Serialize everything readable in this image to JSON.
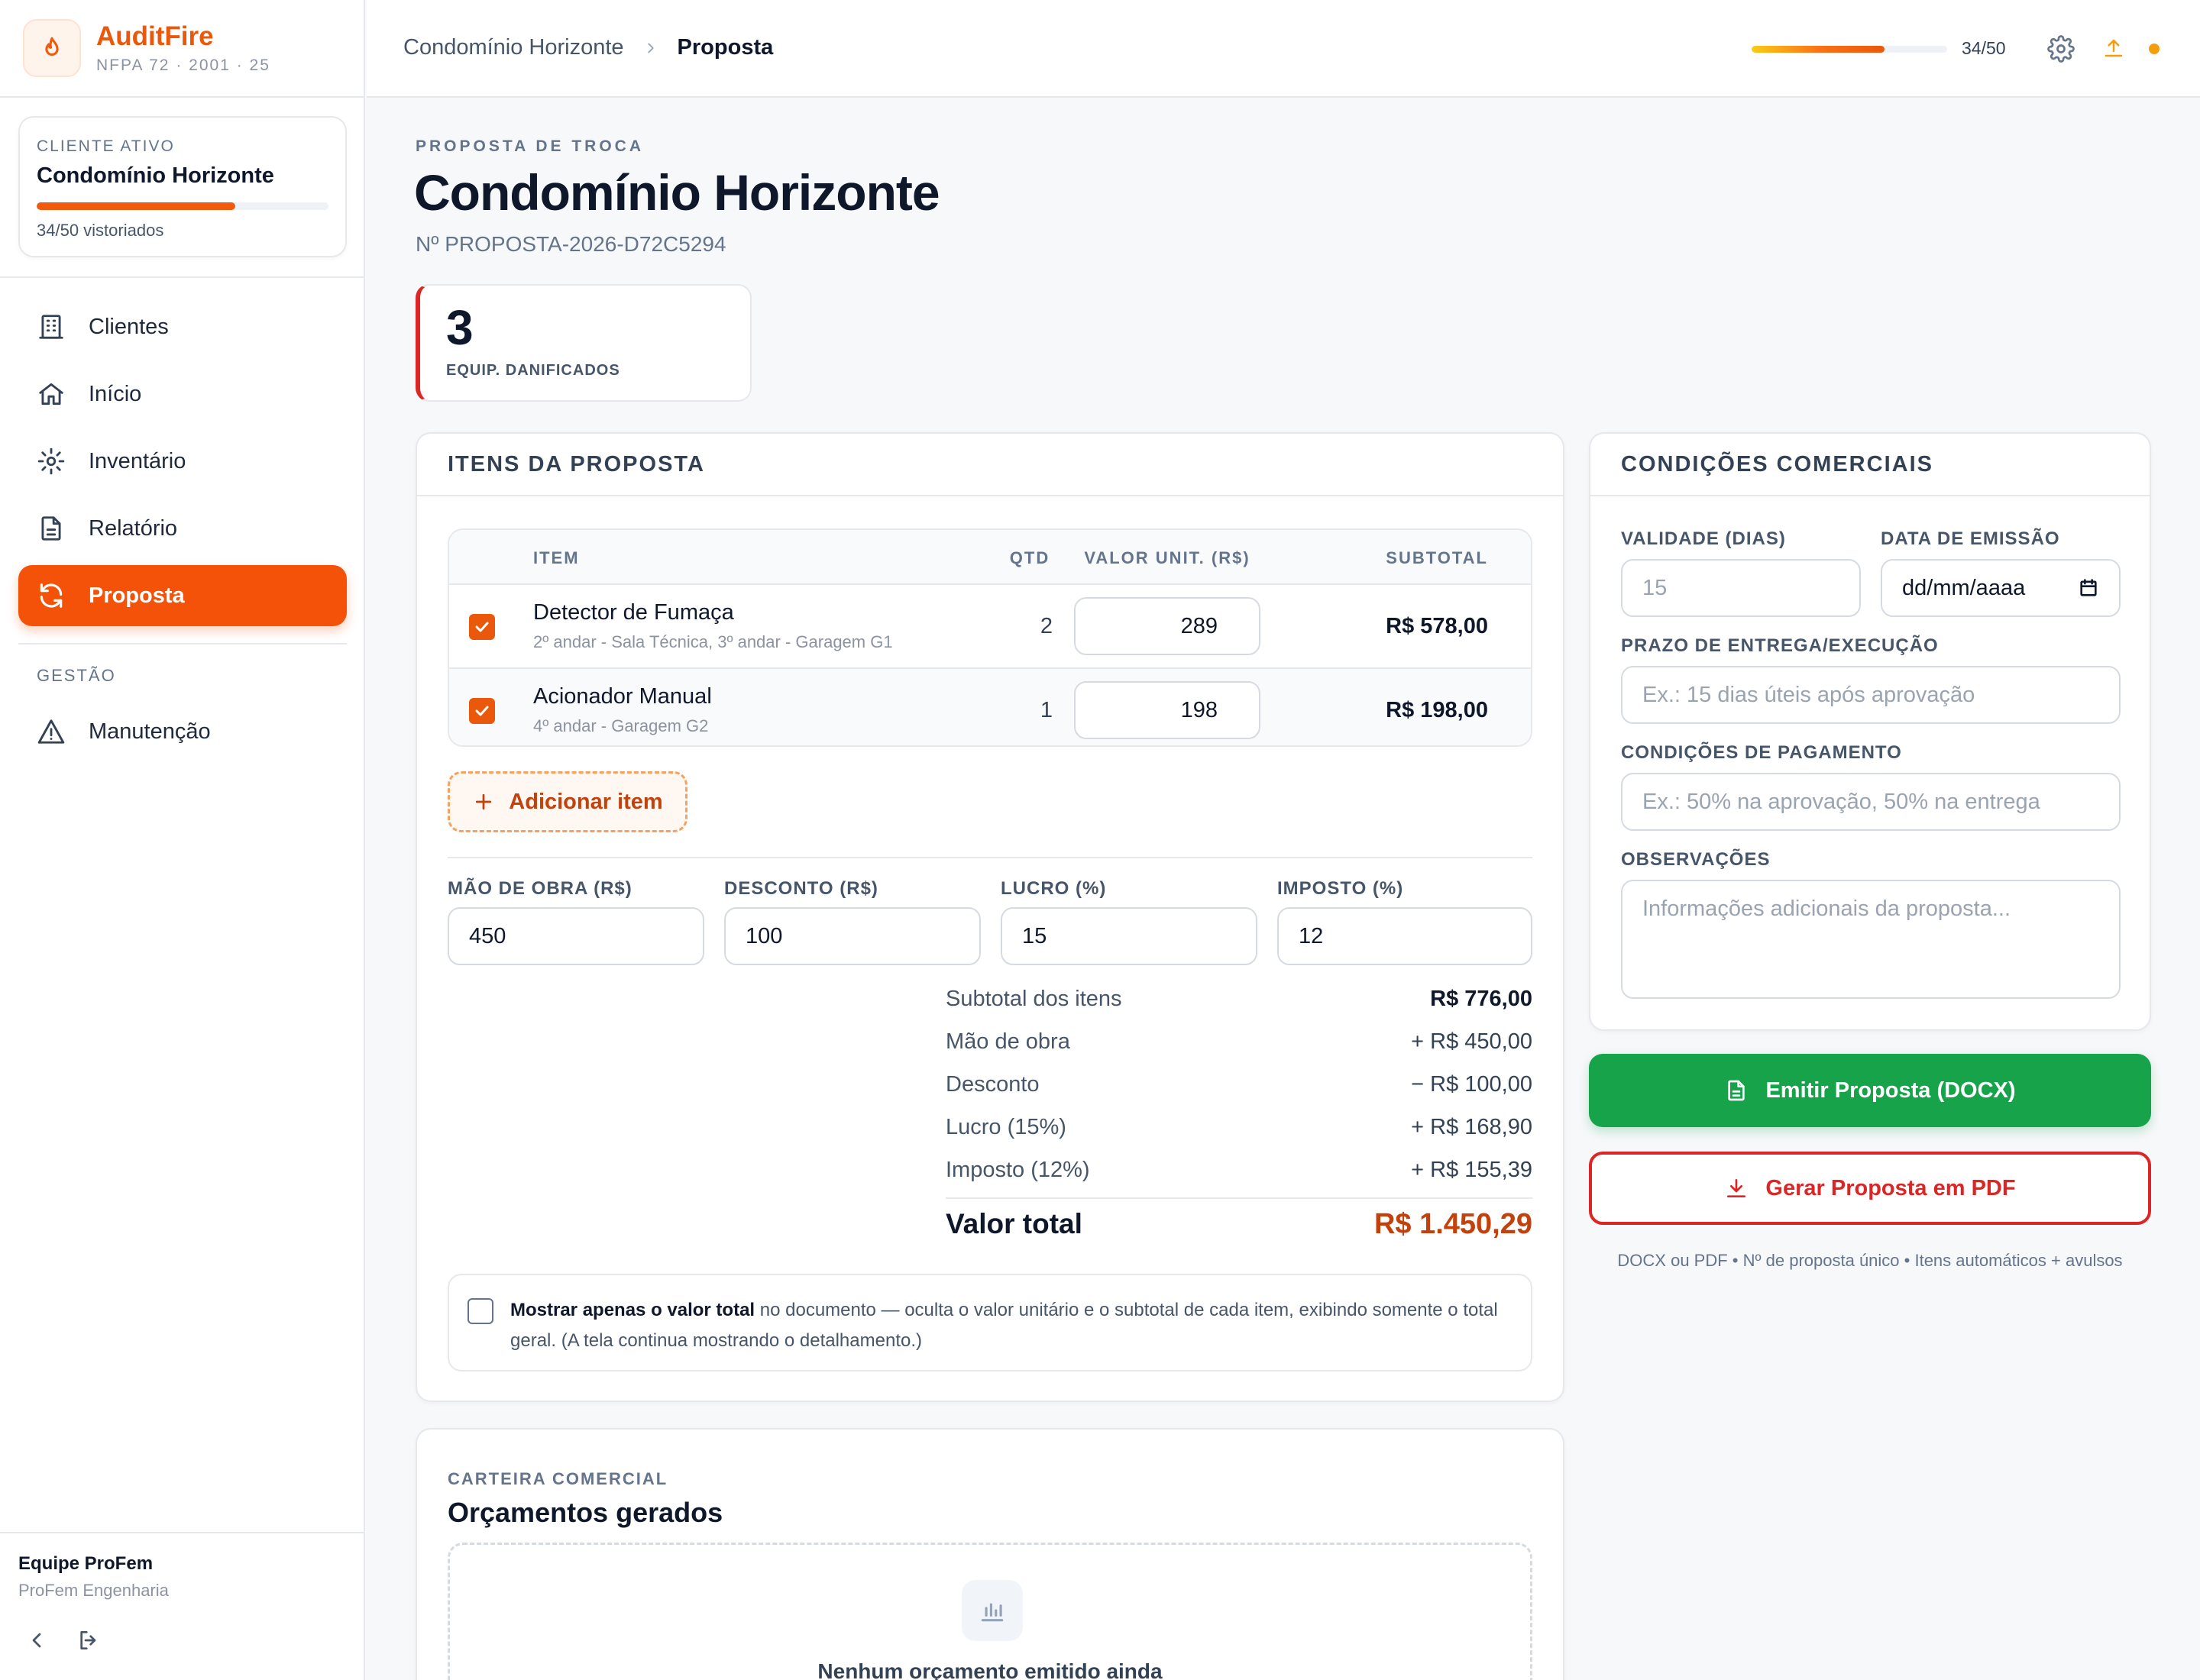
{
  "brand": {
    "name": "AuditFire",
    "subtitle": "NFPA 72 · 2001 · 25"
  },
  "active_client": {
    "label": "CLIENTE ATIVO",
    "name": "Condomínio Horizonte",
    "progress_fraction": 0.68,
    "count_text": "34/50 vistoriados"
  },
  "nav": {
    "items": [
      {
        "label": "Clientes",
        "icon": "building-icon"
      },
      {
        "label": "Início",
        "icon": "home-icon"
      },
      {
        "label": "Inventário",
        "icon": "gear-icon"
      },
      {
        "label": "Relatório",
        "icon": "document-icon"
      },
      {
        "label": "Proposta",
        "icon": "refresh-icon",
        "active": true
      }
    ],
    "section_label": "GESTÃO",
    "section_items": [
      {
        "label": "Manutenção",
        "icon": "warning-icon"
      }
    ]
  },
  "footer": {
    "team": "Equipe ProFem",
    "org": "ProFem Engenharia"
  },
  "topbar": {
    "crumb_parent": "Condomínio Horizonte",
    "crumb_current": "Proposta",
    "progress_fraction": 0.68,
    "count": "34/50",
    "status_color": "#f59e0b"
  },
  "header": {
    "eyebrow": "PROPOSTA DE TROCA",
    "title": "Condomínio Horizonte",
    "proposal_no": "Nº PROPOSTA-2026-D72C5294"
  },
  "stat": {
    "value": "3",
    "label": "EQUIP. DANIFICADOS"
  },
  "items_panel": {
    "title": "ITENS DA PROPOSTA",
    "columns": {
      "item": "ITEM",
      "qty": "QTD",
      "unit": "VALOR UNIT. (R$)",
      "subtotal": "SUBTOTAL"
    },
    "rows": [
      {
        "checked": true,
        "name": "Detector de Fumaça",
        "location": "2º andar - Sala Técnica, 3º andar - Garagem G1",
        "qty": "2",
        "unit_value": "289",
        "subtotal": "R$ 578,00"
      },
      {
        "checked": true,
        "name": "Acionador Manual",
        "location": "4º andar - Garagem G2",
        "qty": "1",
        "unit_value": "198",
        "subtotal": "R$ 198,00"
      }
    ],
    "add_label": "Adicionar item",
    "fields": [
      {
        "label": "MÃO DE OBRA (R$)",
        "value": "450"
      },
      {
        "label": "DESCONTO (R$)",
        "value": "100"
      },
      {
        "label": "LUCRO (%)",
        "value": "15"
      },
      {
        "label": "IMPOSTO (%)",
        "value": "12"
      }
    ],
    "summary": [
      {
        "label": "Subtotal dos itens",
        "value": "R$ 776,00"
      },
      {
        "label": "Mão de obra",
        "value": "+ R$ 450,00"
      },
      {
        "label": "Desconto",
        "value": "− R$ 100,00"
      },
      {
        "label": "Lucro (15%)",
        "value": "+ R$ 168,90"
      },
      {
        "label": "Imposto (12%)",
        "value": "+ R$ 155,39"
      }
    ],
    "total_label": "Valor total",
    "total_value": "R$ 1.450,29",
    "option": {
      "strong": "Mostrar apenas o valor total",
      "text": " no documento — oculta o valor unitário e o subtotal de cada item, exibindo somente o total geral. (A tela continua mostrando o detalhamento.)"
    }
  },
  "conditions": {
    "title": "CONDIÇÕES COMERCIAIS",
    "validity_label": "VALIDADE (DIAS)",
    "validity_placeholder": "15",
    "date_label": "DATA DE EMISSÃO",
    "date_value": "dd/mm/aaaa",
    "delivery_label": "PRAZO DE ENTREGA/EXECUÇÃO",
    "delivery_placeholder": "Ex.: 15 dias úteis após aprovação",
    "payment_label": "CONDIÇÕES DE PAGAMENTO",
    "payment_placeholder": "Ex.: 50% na aprovação, 50% na entrega",
    "notes_label": "OBSERVAÇÕES",
    "notes_placeholder": "Informações adicionais da proposta..."
  },
  "actions": {
    "docx": "Emitir Proposta (DOCX)",
    "pdf": "Gerar Proposta em PDF",
    "note": "DOCX ou PDF • Nº de proposta único • Itens automáticos + avulsos"
  },
  "portfolio": {
    "eyebrow": "CARTEIRA COMERCIAL",
    "title": "Orçamentos gerados",
    "empty": "Nenhum orçamento emitido ainda"
  },
  "colors": {
    "accent": "#f45208",
    "success": "#16a34a",
    "danger": "#dc2626",
    "total": "#c2410c"
  }
}
